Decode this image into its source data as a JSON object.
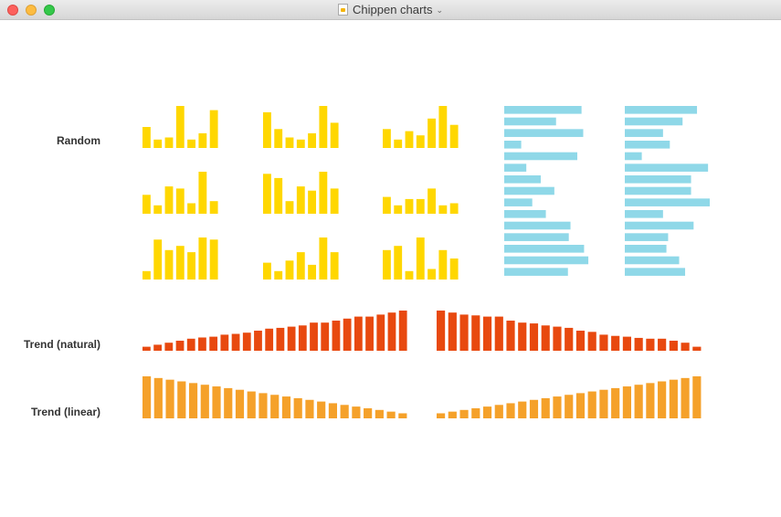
{
  "window": {
    "title": "Chippen charts",
    "traffic_lights": {
      "close": "#fc605c",
      "minimize": "#fdbc40",
      "zoom": "#34c84a"
    }
  },
  "labels": {
    "random": "Random",
    "trend_natural": "Trend (natural)",
    "trend_linear": "Trend (linear)"
  },
  "colors": {
    "random_bars": "#ffd700",
    "random_hbars": "#8fd8e8",
    "trend_natural": "#e8490f",
    "trend_linear": "#f5a12a"
  },
  "chart_data": [
    {
      "type": "bar",
      "name": "random-1",
      "values": [
        5,
        2,
        2.5,
        10,
        2,
        3.5,
        9
      ],
      "ylim": [
        0,
        10
      ]
    },
    {
      "type": "bar",
      "name": "random-2",
      "values": [
        8.5,
        4.5,
        2.5,
        2,
        3.5,
        10,
        6
      ],
      "ylim": [
        0,
        10
      ]
    },
    {
      "type": "bar",
      "name": "random-3",
      "values": [
        4.5,
        2,
        4,
        3,
        7,
        10,
        5.5
      ],
      "ylim": [
        0,
        10
      ]
    },
    {
      "type": "bar",
      "name": "random-4",
      "values": [
        4.5,
        2,
        6.5,
        6,
        2.5,
        10,
        3
      ],
      "ylim": [
        0,
        10
      ]
    },
    {
      "type": "bar",
      "name": "random-5",
      "values": [
        9.5,
        8.5,
        3,
        6.5,
        5.5,
        10,
        6
      ],
      "ylim": [
        0,
        10
      ]
    },
    {
      "type": "bar",
      "name": "random-6",
      "values": [
        4,
        2,
        3.5,
        3.5,
        6,
        2,
        2.5
      ],
      "ylim": [
        0,
        10
      ]
    },
    {
      "type": "bar",
      "name": "random-7",
      "values": [
        2,
        9.5,
        7,
        8,
        6.5,
        10,
        9.5
      ],
      "ylim": [
        0,
        10
      ]
    },
    {
      "type": "bar",
      "name": "random-8",
      "values": [
        4,
        2,
        4.5,
        6.5,
        3.5,
        10,
        6.5
      ],
      "ylim": [
        0,
        10
      ]
    },
    {
      "type": "bar",
      "name": "random-9",
      "values": [
        7,
        8,
        2,
        10,
        2.5,
        7,
        5
      ],
      "ylim": [
        0,
        10
      ]
    },
    {
      "type": "hbar",
      "name": "random-hbar-1",
      "values": [
        9.1,
        6.1,
        9.3,
        2,
        8.6,
        2.6,
        4.3,
        5.9,
        3.3,
        4.9,
        7.8,
        7.6,
        9.4,
        9.9,
        7.5
      ],
      "xlim": [
        0,
        10
      ]
    },
    {
      "type": "hbar",
      "name": "random-hbar-2",
      "values": [
        8.5,
        6.8,
        4.5,
        5.3,
        2,
        9.8,
        7.8,
        7.8,
        10,
        4.5,
        8.1,
        5.1,
        4.9,
        6.4,
        7.1
      ],
      "xlim": [
        0,
        10
      ]
    },
    {
      "type": "bar",
      "name": "trend-natural-up",
      "values": [
        1,
        1.5,
        2,
        2.5,
        3,
        3.3,
        3.5,
        4,
        4.2,
        4.5,
        5,
        5.5,
        5.7,
        6,
        6.3,
        7,
        7,
        7.5,
        8,
        8.5,
        8.5,
        9,
        9.5,
        10
      ],
      "ylim": [
        0,
        10
      ]
    },
    {
      "type": "bar",
      "name": "trend-natural-down",
      "values": [
        10,
        9.5,
        9,
        8.8,
        8.5,
        8.5,
        7.5,
        7,
        6.8,
        6.3,
        6,
        5.7,
        5,
        4.7,
        4,
        3.7,
        3.5,
        3.2,
        3,
        3,
        2.5,
        2,
        1
      ],
      "ylim": [
        0,
        10
      ]
    },
    {
      "type": "bar",
      "name": "trend-linear-down",
      "values": [
        10,
        9.6,
        9.2,
        8.8,
        8.4,
        8,
        7.6,
        7.2,
        6.8,
        6.4,
        6,
        5.6,
        5.2,
        4.8,
        4.4,
        4,
        3.6,
        3.2,
        2.8,
        2.4,
        2,
        1.6,
        1.2
      ],
      "ylim": [
        0,
        10
      ]
    },
    {
      "type": "bar",
      "name": "trend-linear-up",
      "values": [
        1.2,
        1.6,
        2,
        2.4,
        2.8,
        3.2,
        3.6,
        4,
        4.4,
        4.8,
        5.2,
        5.6,
        6,
        6.4,
        6.8,
        7.2,
        7.6,
        8,
        8.4,
        8.8,
        9.2,
        9.6,
        10
      ],
      "ylim": [
        0,
        10
      ]
    }
  ]
}
